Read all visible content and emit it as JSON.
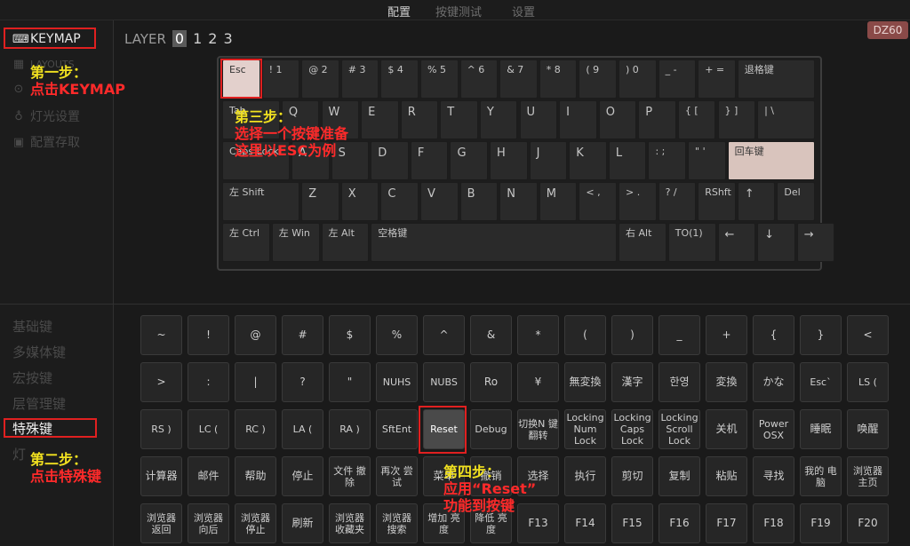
{
  "top_tabs": [
    {
      "label": "配置",
      "active": true
    },
    {
      "label": "按键测试",
      "active": false
    },
    {
      "label": "设置",
      "active": false
    }
  ],
  "sidebar": {
    "nav": [
      {
        "label": "KEYMAP",
        "icon": "keyboard-icon",
        "active": true
      },
      {
        "label": "LAYOUTS",
        "icon": "grid-icon",
        "active": false
      },
      {
        "label": "",
        "icon": "macro-icon",
        "active": false
      },
      {
        "label": "灯光设置",
        "icon": "bulb-icon",
        "active": false
      },
      {
        "label": "配置存取",
        "icon": "save-icon",
        "active": false
      }
    ],
    "categories": [
      {
        "label": "基础键",
        "active": false
      },
      {
        "label": "多媒体键",
        "active": false
      },
      {
        "label": "宏按键",
        "active": false
      },
      {
        "label": "层管理键",
        "active": false
      },
      {
        "label": "特殊键",
        "active": true
      },
      {
        "label": "灯",
        "active": false
      }
    ]
  },
  "layer": {
    "label": "LAYER",
    "numbers": [
      "0",
      "1",
      "2",
      "3"
    ],
    "selected": "0"
  },
  "badge": "DZ60",
  "keyboard_rows": [
    [
      "Esc",
      "! 1",
      "@ 2",
      "# 3",
      "$ 4",
      "% 5",
      "^ 6",
      "& 7",
      "* 8",
      "( 9",
      ") 0",
      "_ -",
      "+ =",
      "退格键"
    ],
    [
      "Tab",
      "Q",
      "W",
      "E",
      "R",
      "T",
      "Y",
      "U",
      "I",
      "O",
      "P",
      "{ [",
      "} ]",
      "| \\"
    ],
    [
      "Caps Lock",
      "A",
      "S",
      "D",
      "F",
      "G",
      "H",
      "J",
      "K",
      "L",
      ": ;",
      "\" '",
      "回车键"
    ],
    [
      "左 Shift",
      "Z",
      "X",
      "C",
      "V",
      "B",
      "N",
      "M",
      "< ,",
      "> .",
      "? /",
      "RShft",
      "↑",
      "Del"
    ],
    [
      "左 Ctrl",
      "左 Win",
      "左 Alt",
      "空格键",
      "右 Alt",
      "TO(1)",
      "←",
      "↓",
      "→"
    ]
  ],
  "special_keys": [
    [
      "~",
      "!",
      "@",
      "#",
      "$",
      "%",
      "^",
      "&",
      "*",
      "(",
      ")",
      "_",
      "+",
      "{",
      "}",
      "<"
    ],
    [
      ">",
      ":",
      "|",
      "?",
      "\"",
      "NUHS",
      "NUBS",
      "Ro",
      "¥",
      "無変換",
      "漢字",
      "한영",
      "変換",
      "かな",
      "Esc`",
      "LS ("
    ],
    [
      "RS )",
      "LC (",
      "RC )",
      "LA (",
      "RA )",
      "SftEnt",
      "Reset",
      "Debug",
      "切换N 键翻转",
      "Locking Num Lock",
      "Locking Caps Lock",
      "Locking Scroll Lock",
      "关机",
      "Power OSX",
      "睡眠",
      "唤醒"
    ],
    [
      "计算器",
      "邮件",
      "帮助",
      "停止",
      "文件 撤除",
      "再次 尝试",
      "菜单",
      "撤销",
      "选择",
      "执行",
      "剪切",
      "复制",
      "粘贴",
      "寻找",
      "我的 电脑",
      "浏览器 主页"
    ],
    [
      "浏览器 返回",
      "浏览器 向后",
      "浏览器 停止",
      "刷新",
      "浏览器 收藏夹",
      "浏览器 搜索",
      "增加 亮度",
      "降低 亮度",
      "F13",
      "F14",
      "F15",
      "F16",
      "F17",
      "F18",
      "F19",
      "F20"
    ]
  ],
  "selected_special_key": "Reset",
  "annotations": {
    "step1": [
      "第一步：",
      "点击KEYMAP"
    ],
    "step2": [
      "第二步：",
      "点击特殊键"
    ],
    "step3": [
      "第三步：",
      "选择一个按键准备",
      "这里以ESC为例"
    ],
    "step4": [
      "第四步：",
      "应用“Reset”",
      "功能到按键"
    ]
  },
  "colors": {
    "annotation_yellow": "#f0e020",
    "annotation_red": "#ff2a2a",
    "highlight_box": "#e02020",
    "selected_key": "#e3d0cc",
    "badge_bg": "#8a4a48"
  }
}
